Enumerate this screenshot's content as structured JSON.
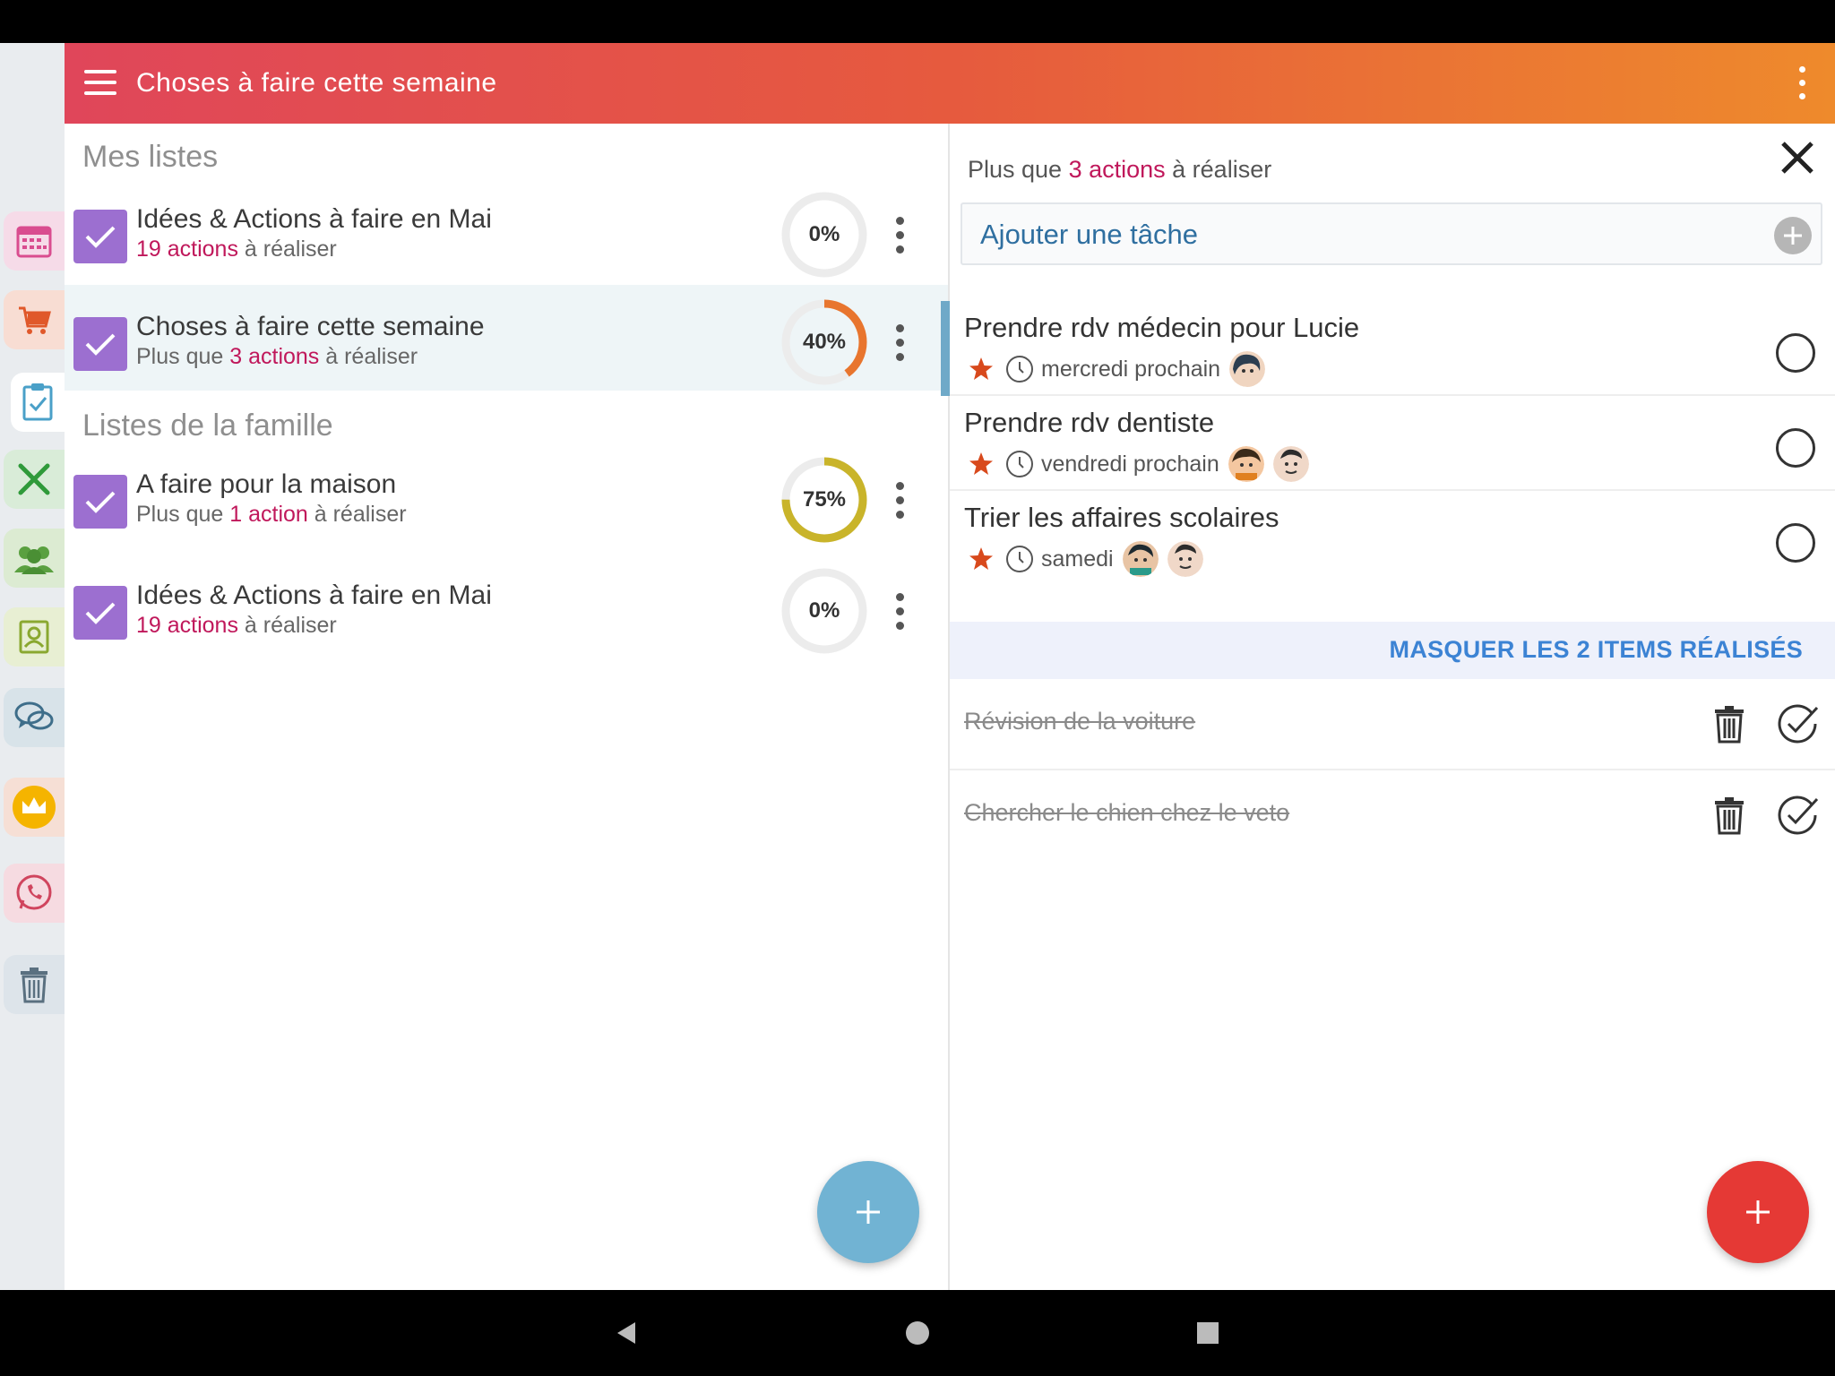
{
  "app": {
    "title": "Choses à faire cette semaine"
  },
  "rail": {
    "items": [
      {
        "icon": "calendar-icon",
        "color": "#e05a9a"
      },
      {
        "icon": "cart-icon",
        "color": "#e0582a"
      },
      {
        "icon": "clipboard-check-icon",
        "color": "#4aa0c8"
      },
      {
        "icon": "fork-knife-icon",
        "color": "#2f9a3a"
      },
      {
        "icon": "group-icon",
        "color": "#5aa040"
      },
      {
        "icon": "contact-book-icon",
        "color": "#8aa830"
      },
      {
        "icon": "chat-icon",
        "color": "#3e6e8a"
      },
      {
        "icon": "crown-icon",
        "color": "#f5b400"
      },
      {
        "icon": "whatsapp-icon",
        "color": "#d0455e"
      },
      {
        "icon": "trash-icon",
        "color": "#5a7080"
      }
    ]
  },
  "left": {
    "section_my_lists": "Mes listes",
    "section_family_lists": "Listes de la famille",
    "lists": [
      {
        "name": "Idées & Actions à faire en Mai",
        "sub_prefix": "",
        "sub_accent": "19 actions",
        "sub_suffix": " à réaliser",
        "percent_label": "0%",
        "percent": 0,
        "color": "#e6e6e6"
      },
      {
        "name": "Choses à faire cette semaine",
        "sub_prefix": "Plus que ",
        "sub_accent": "3 actions",
        "sub_suffix": " à réaliser",
        "percent_label": "40%",
        "percent": 40,
        "color": "#e8752e"
      },
      {
        "name": "A faire pour la maison",
        "sub_prefix": "Plus que ",
        "sub_accent": "1 action",
        "sub_suffix": " à réaliser",
        "percent_label": "75%",
        "percent": 75,
        "color": "#c9b42a"
      },
      {
        "name": "Idées & Actions à faire en Mai",
        "sub_prefix": "",
        "sub_accent": "19 actions",
        "sub_suffix": " à réaliser",
        "percent_label": "0%",
        "percent": 0,
        "color": "#e6e6e6"
      }
    ]
  },
  "right": {
    "header_prefix": "Plus que ",
    "header_accent": "3 actions",
    "header_suffix": " à réaliser",
    "add_task_label": "Ajouter une tâche",
    "tasks": [
      {
        "title": "Prendre rdv médecin pour Lucie",
        "due": "mercredi prochain"
      },
      {
        "title": "Prendre rdv dentiste",
        "due": "vendredi prochain"
      },
      {
        "title": "Trier les affaires scolaires",
        "due": "samedi"
      }
    ],
    "done_banner": "MASQUER LES 2 ITEMS RÉALISÉS",
    "done_items": [
      {
        "title": "Révision de la voiture"
      },
      {
        "title": "Chercher le chien chez le veto"
      }
    ]
  }
}
